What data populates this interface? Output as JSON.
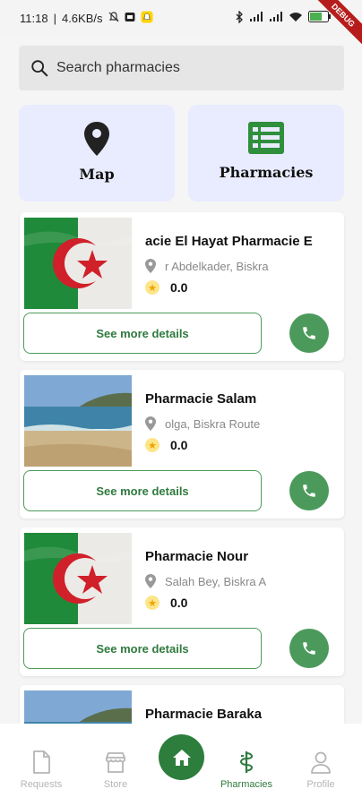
{
  "status_bar": {
    "time": "11:18",
    "network_speed": "4.6KB/s",
    "battery": "60",
    "debug_label": "DEBUG"
  },
  "search": {
    "placeholder": "Search pharmacies"
  },
  "tiles": {
    "map_label": "Map",
    "pharmacies_label": "Pharmacies"
  },
  "colors": {
    "accent": "#4c9a5b",
    "accent_dark": "#2d7d3c",
    "tile_bg": "#e9ebff"
  },
  "pharmacies": [
    {
      "name": "acie El Hayat   Pharmacie E",
      "address": "r Abdelkader, Biskra",
      "rating": "0.0",
      "image": "algeria-flag",
      "details_label": "See more details"
    },
    {
      "name": "Pharmacie Salam",
      "address": "olga, Biskra   Route",
      "rating": "0.0",
      "image": "beach-photo",
      "details_label": "See more details"
    },
    {
      "name": "Pharmacie Nour",
      "address": "Salah Bey, Biskra   A",
      "rating": "0.0",
      "image": "algeria-flag",
      "details_label": "See more details"
    },
    {
      "name": "Pharmacie Baraka",
      "address": "",
      "rating": "",
      "image": "beach-photo",
      "details_label": ""
    }
  ],
  "bottom_nav": {
    "items": [
      {
        "label": "Requests",
        "icon": "document-icon"
      },
      {
        "label": "Store",
        "icon": "store-icon"
      },
      {
        "label": "",
        "icon": "home-icon"
      },
      {
        "label": "Pharmacies",
        "icon": "pharmacy-icon"
      },
      {
        "label": "Profile",
        "icon": "profile-icon"
      }
    ]
  }
}
